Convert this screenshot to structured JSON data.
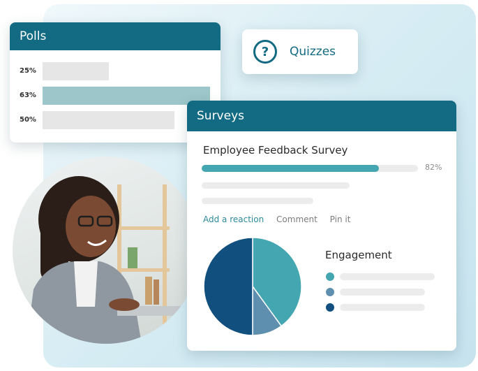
{
  "polls": {
    "title": "Polls",
    "options": [
      {
        "label": "25%",
        "value": 25
      },
      {
        "label": "63%",
        "value": 63
      },
      {
        "label": "50%",
        "value": 50
      }
    ]
  },
  "quizzes": {
    "label": "Quizzes",
    "icon": "question-icon"
  },
  "surveys": {
    "title": "Surveys",
    "survey_name": "Employee Feedback Survey",
    "progress": 82,
    "progress_label": "82%",
    "actions": {
      "reaction": "Add a reaction",
      "comment": "Comment",
      "pin": "Pin it"
    },
    "engagement": {
      "title": "Engagement",
      "colors": [
        "#44a6b0",
        "#5f8fae",
        "#114f7e"
      ],
      "slices": [
        40,
        10,
        50
      ]
    }
  },
  "colors": {
    "header": "#136a83",
    "accent": "#44a6b0",
    "poll_highlight": "#9cc6c9"
  }
}
